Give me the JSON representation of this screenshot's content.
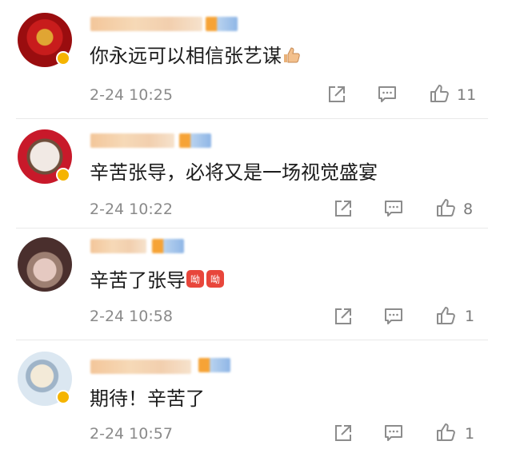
{
  "comments": [
    {
      "text": "你永远可以相信张艺谋",
      "emoji": "thumbs-up-emoji",
      "time": "2-24 10:25",
      "likes": "11",
      "avatar_colors": [
        "#9a0d0f",
        "#c81c1c",
        "#e0a533"
      ]
    },
    {
      "text": "辛苦张导，必将又是一场视觉盛宴",
      "time": "2-24 10:22",
      "likes": "8",
      "avatar_colors": [
        "#c8192a",
        "#f1e9e4",
        "#6e4d3a"
      ]
    },
    {
      "text": "辛苦了张导",
      "emoji": "cry-emoji",
      "time": "2-24 10:58",
      "likes": "1",
      "avatar_colors": [
        "#4a2f2d",
        "#e5c9c1",
        "#9d7f72"
      ]
    },
    {
      "text": "期待！辛苦了",
      "time": "2-24 10:57",
      "likes": "1",
      "avatar_colors": [
        "#dbe7f1",
        "#f3ead8",
        "#9fb4c8"
      ]
    }
  ],
  "icons": {
    "share": "share-icon",
    "comment": "comment-icon",
    "like": "like-icon"
  },
  "colors": {
    "text": "#1c1c1c",
    "meta": "#8a8a8a",
    "verified_badge": "#f5b400"
  }
}
